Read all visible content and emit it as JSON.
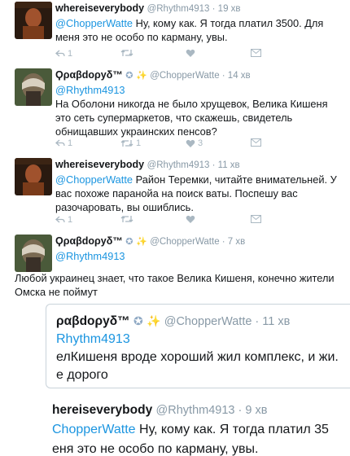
{
  "tweets": [
    {
      "name": "whereiseverybody",
      "meta": "@Rhythm4913 · 19 хв",
      "mention": "@ChopperWatte",
      "text": " Ну, кому как. Я тогда платил 3500. Для меня это не особо по карману, увы.",
      "reply_count": "1",
      "retweet_count": "",
      "like_count": ""
    },
    {
      "name": "Ϙραβdορуδ™",
      "verified": "✪",
      "spark": "✨",
      "meta": "@ChopperWatte · 14 хв",
      "mention": "@Rhythm4913",
      "text": "На Оболони никогда не было хрущевок, Велика Кишеня это сеть супермаркетов, что скажешь, свидетель обнищавших украинских пенсов?",
      "reply_count": "1",
      "retweet_count": "1",
      "like_count": "3"
    },
    {
      "name": "whereiseverybody",
      "meta": "@Rhythm4913 · 11 хв",
      "mention": "@ChopperWatte",
      "text": " Район Теремки, читайте внимательней. У вас похоже паранойа на поиск ваты. Поспешу вас разочаровать, вы ошиблись.",
      "reply_count": "1",
      "retweet_count": "",
      "like_count": ""
    },
    {
      "name": "Ϙραβdορуδ™",
      "verified": "✪",
      "spark": "✨",
      "meta": "@ChopperWatte · 7 хв",
      "mention": "@Rhythm4913",
      "text": "Любой украинец знает, что такое Велика Кишеня, конечно жители Омска не поймут"
    }
  ],
  "quote": {
    "name": "ραβdορуδ™",
    "verified": "✪",
    "spark": "✨",
    "meta": "@ChopperWatte · 11 хв",
    "mention": "Rhythm4913",
    "line1": "елКишеня вроде хороший жил комплекс, и жи.",
    "line2": "е дорого"
  },
  "big_tweet": {
    "name": "hereiseverybody",
    "meta": "@Rhythm4913 · 9 хв",
    "mention": "ChopperWatte",
    "line1": " Ну, кому как. Я тогда платил 35",
    "line2": "еня это не особо по карману, увы."
  },
  "icons": {
    "reply": "reply-icon",
    "retweet": "retweet-icon",
    "like": "heart-icon",
    "dm": "envelope-icon"
  },
  "colors": {
    "mention": "#1b95e0",
    "meta": "#8899a6",
    "action": "#aab8c2"
  }
}
